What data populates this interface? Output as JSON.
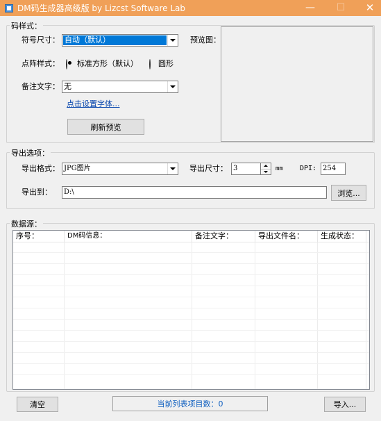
{
  "window": {
    "title": "DM码生成器高级版  by Lizcst Software Lab",
    "minimize_glyph": "—",
    "maximize_glyph": "☐",
    "close_glyph": "✕",
    "titlebar_color": "#f0a058",
    "icon": "app-icon"
  },
  "code_style": {
    "group_label": "码样式：",
    "symbol_size_label": "符号尺寸：",
    "symbol_size_value": "自动（默认）",
    "dot_style_label": "点阵样式：",
    "dot_style_options": [
      "标准方形（默认）",
      "圆形"
    ],
    "note_text_label": "备注文字：",
    "note_text_value": "无",
    "font_link": "点击设置字体...",
    "refresh_button": "刷新预览",
    "preview_label": "预览图："
  },
  "export_options": {
    "group_label": "导出选项：",
    "format_label": "导出格式：",
    "format_value": "JPG图片",
    "size_label": "导出尺寸：",
    "size_value": "3",
    "size_unit": "mm",
    "dpi_label": "DPI:",
    "dpi_value": "254",
    "path_label": "导出到：",
    "path_value": "D:\\",
    "browse_button": "浏览..."
  },
  "data_source": {
    "group_label": "数据源：",
    "columns": [
      "序号：",
      "DM码信息：",
      "备注文字：",
      "导出文件名：",
      "生成状态："
    ],
    "rows": []
  },
  "footer": {
    "clear_button": "清空",
    "status_text": "当前列表项目数：0",
    "import_button": "导入..."
  }
}
